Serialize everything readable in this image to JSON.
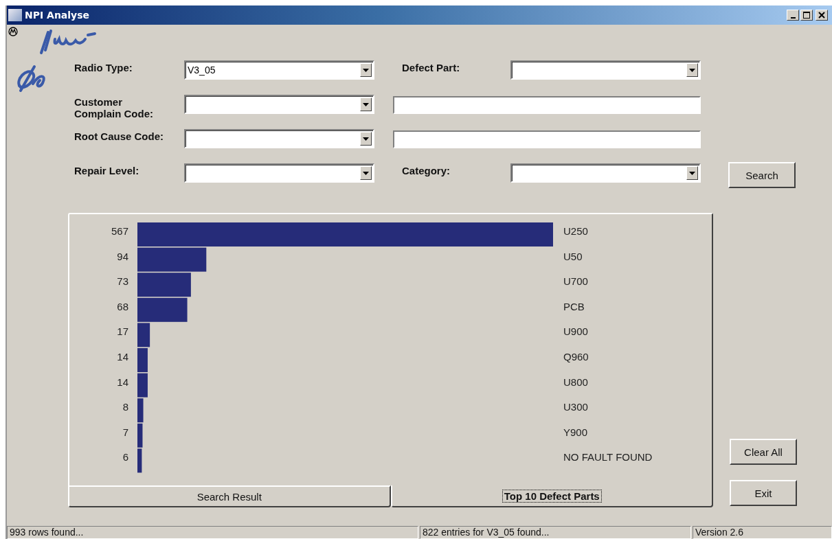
{
  "window": {
    "title": "NPI Analyse"
  },
  "form_rows": [
    {
      "cells": [
        {
          "kind": "label",
          "text": "Radio Type:"
        },
        {
          "kind": "combo",
          "value": "V3_05"
        },
        {
          "kind": "label",
          "text": "Defect Part:"
        },
        {
          "kind": "combo"
        }
      ]
    },
    {
      "cells": [
        {
          "kind": "label",
          "text": "Customer Complain Code:"
        },
        {
          "kind": "combo"
        },
        {
          "kind": "text"
        }
      ]
    },
    {
      "cells": [
        {
          "kind": "label",
          "text": "Root Cause Code:"
        },
        {
          "kind": "combo"
        },
        {
          "kind": "text"
        }
      ]
    },
    {
      "cells": [
        {
          "kind": "label",
          "text": "Repair Level:"
        },
        {
          "kind": "combo"
        },
        {
          "kind": "label",
          "text": "Category:"
        },
        {
          "kind": "combo"
        },
        {
          "kind": "button",
          "text": "Search"
        }
      ]
    }
  ],
  "chart": {
    "chart_data": {
      "type": "bar",
      "orientation": "horizontal",
      "data_labels": true,
      "categories": [
        "U250",
        "U50",
        "U700",
        "PCB",
        "U900",
        "Q960",
        "U800",
        "U300",
        "Y900",
        "NO FAULT FOUND"
      ],
      "values": [
        567,
        94,
        73,
        68,
        17,
        14,
        14,
        8,
        7,
        6
      ]
    }
  },
  "tabs": [
    {
      "label": "Search Result",
      "selected": false
    },
    {
      "label": "Top 10 Defect Parts",
      "selected": true
    }
  ],
  "side_buttons": [
    "Clear All",
    "Exit"
  ],
  "status_bar": [
    "993 rows found...",
    "822 entries for V3_05 found...",
    "Version 2.6"
  ]
}
